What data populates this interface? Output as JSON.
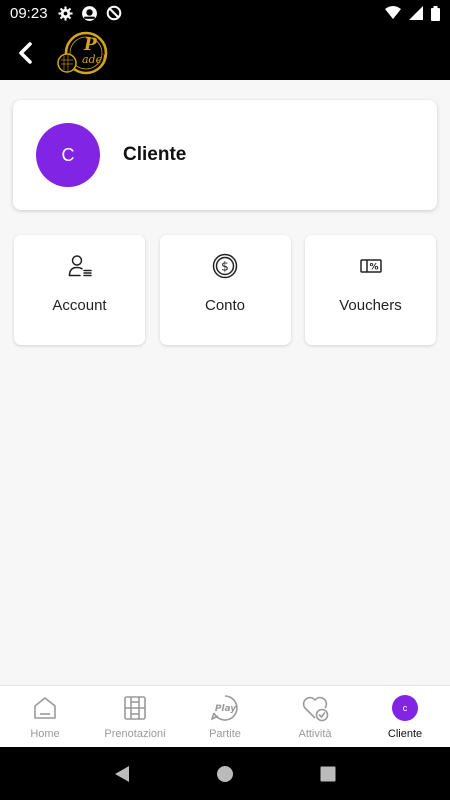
{
  "status_bar": {
    "time": "09:23"
  },
  "profile": {
    "initial": "C",
    "name": "Cliente"
  },
  "tiles": [
    {
      "label": "Account",
      "icon": "user-list-icon"
    },
    {
      "label": "Conto",
      "icon": "dollar-coin-icon"
    },
    {
      "label": "Vouchers",
      "icon": "voucher-percent-icon"
    }
  ],
  "bottom_nav": {
    "items": [
      {
        "label": "Home",
        "icon": "home-icon"
      },
      {
        "label": "Prenotazioni",
        "icon": "court-grid-icon"
      },
      {
        "label": "Partite",
        "icon": "play-badge-icon",
        "icon_text": "Play"
      },
      {
        "label": "Attività",
        "icon": "heart-check-icon"
      },
      {
        "label": "Cliente",
        "icon": "avatar",
        "avatar_initial": "c"
      }
    ],
    "active_index": 4
  },
  "colors": {
    "accent": "#8224e3",
    "bar": "#000000",
    "logo_gold": "#d4a514"
  }
}
